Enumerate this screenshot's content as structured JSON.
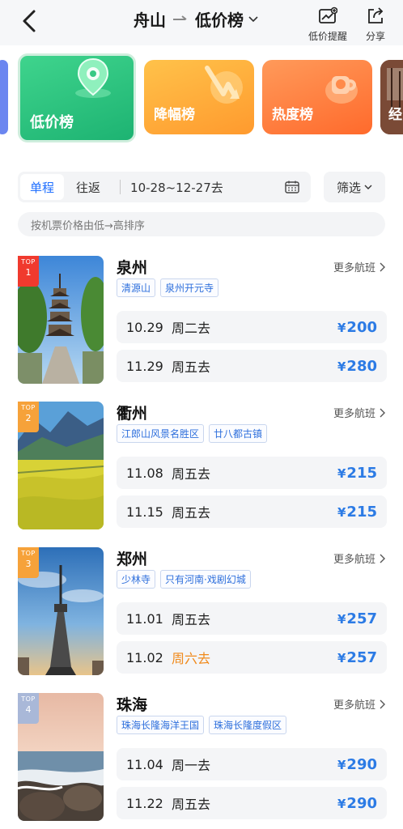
{
  "header": {
    "from": "舟山",
    "list_name": "低价榜",
    "remind_label": "低价提醒",
    "share_label": "分享"
  },
  "rank_cards": [
    {
      "label": "低价榜",
      "active": true
    },
    {
      "label": "降幅榜"
    },
    {
      "label": "热度榜"
    },
    {
      "label": "经"
    }
  ],
  "filters": {
    "one_way": "单程",
    "round_trip": "往返",
    "dates": "10-28~12-27去",
    "filter": "筛选",
    "sort_hint": "按机票价格由低→高排序"
  },
  "colors": {
    "accent": "#1f6fff",
    "price": "#2c7be5",
    "weekend": "#f08a1c"
  },
  "destinations": [
    {
      "rank_top": "TOP",
      "rank": "1",
      "name": "泉州",
      "more": "更多航班",
      "tags": [
        "清源山",
        "泉州开元寺"
      ],
      "fares": [
        {
          "date": "10.29",
          "day": "周二去",
          "currency": "¥",
          "price": "200"
        },
        {
          "date": "11.29",
          "day": "周五去",
          "currency": "¥",
          "price": "280"
        }
      ]
    },
    {
      "rank_top": "TOP",
      "rank": "2",
      "name": "衢州",
      "more": "更多航班",
      "tags": [
        "江郎山风景名胜区",
        "廿八都古镇"
      ],
      "fares": [
        {
          "date": "11.08",
          "day": "周五去",
          "currency": "¥",
          "price": "215"
        },
        {
          "date": "11.15",
          "day": "周五去",
          "currency": "¥",
          "price": "215"
        }
      ]
    },
    {
      "rank_top": "TOP",
      "rank": "3",
      "name": "郑州",
      "more": "更多航班",
      "tags": [
        "少林寺",
        "只有河南·戏剧幻城"
      ],
      "fares": [
        {
          "date": "11.01",
          "day": "周五去",
          "currency": "¥",
          "price": "257"
        },
        {
          "date": "11.02",
          "day": "周六去",
          "currency": "¥",
          "price": "257"
        }
      ]
    },
    {
      "rank_top": "TOP",
      "rank": "4",
      "name": "珠海",
      "more": "更多航班",
      "tags": [
        "珠海长隆海洋王国",
        "珠海长隆度假区"
      ],
      "fares": [
        {
          "date": "11.04",
          "day": "周一去",
          "currency": "¥",
          "price": "290"
        },
        {
          "date": "11.22",
          "day": "周五去",
          "currency": "¥",
          "price": "290"
        }
      ]
    }
  ]
}
